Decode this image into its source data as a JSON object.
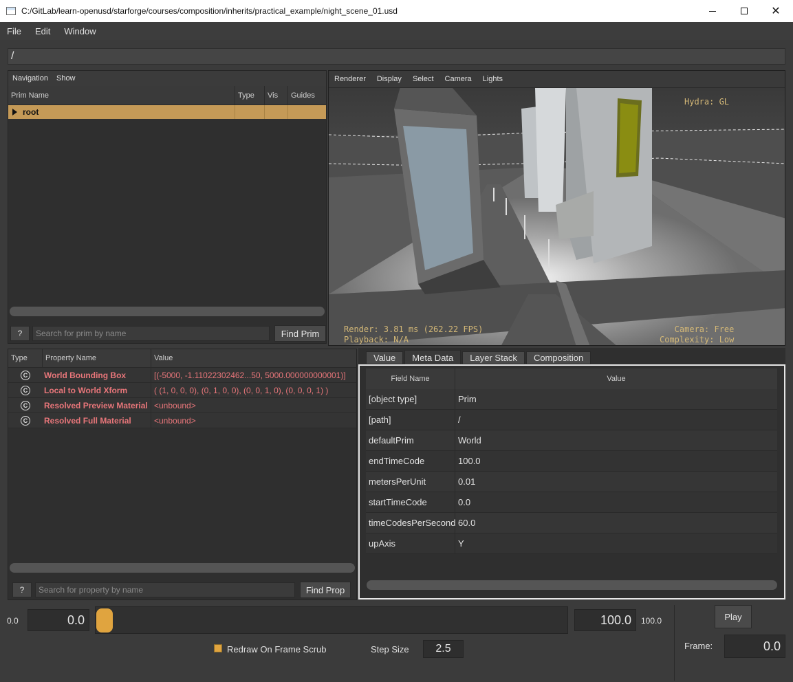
{
  "window": {
    "title": "C:/GitLab/learn-openusd/starforge/courses/composition/inherits/practical_example/night_scene_01.usd",
    "minimize_icon": "minimize-icon",
    "maximize_icon": "maximize-icon",
    "close_icon": "close-icon"
  },
  "menu": [
    "File",
    "Edit",
    "Window"
  ],
  "path_bar": {
    "value": "/"
  },
  "prim_panel": {
    "toolbar": [
      "Navigation",
      "Show"
    ],
    "columns": [
      "Prim Name",
      "Type",
      "Vis",
      "Guides"
    ],
    "rows": [
      {
        "name": "root",
        "type": "",
        "vis": "",
        "guides": ""
      }
    ],
    "help_label": "?",
    "search_placeholder": "Search for prim by name",
    "find_label": "Find Prim"
  },
  "viewport": {
    "toolbar": [
      "Renderer",
      "Display",
      "Select",
      "Camera",
      "Lights"
    ],
    "hud_top_right": "Hydra: GL",
    "hud_bottom_left": "Render: 3.81 ms (262.22 FPS)\nPlayback: N/A",
    "hud_bottom_right": "Camera: Free\nComplexity: Low"
  },
  "property_panel": {
    "columns": [
      "Type",
      "Property Name",
      "Value"
    ],
    "rows": [
      {
        "icon": "computed-icon",
        "type_glyph": "C",
        "name": "World Bounding Box",
        "value": "[(-5000, -1.11022302462...50, 5000.000000000001)]"
      },
      {
        "icon": "computed-icon",
        "type_glyph": "C",
        "name": "Local to World Xform",
        "value": "( (1, 0, 0, 0), (0, 1, 0, 0), (0, 0, 1, 0), (0, 0, 0, 1) )"
      },
      {
        "icon": "computed-icon",
        "type_glyph": "C",
        "name": "Resolved Preview Material",
        "value": "<unbound>"
      },
      {
        "icon": "computed-icon",
        "type_glyph": "C",
        "name": "Resolved Full Material",
        "value": "<unbound>"
      }
    ],
    "help_label": "?",
    "search_placeholder": "Search for property by name",
    "find_label": "Find Prop"
  },
  "meta_panel": {
    "tabs": [
      "Value",
      "Meta Data",
      "Layer Stack",
      "Composition"
    ],
    "active_tab": "Meta Data",
    "columns": [
      "Field Name",
      "Value"
    ],
    "rows": [
      {
        "field": "[object type]",
        "value": "Prim"
      },
      {
        "field": "[path]",
        "value": "/"
      },
      {
        "field": "defaultPrim",
        "value": "World"
      },
      {
        "field": "endTimeCode",
        "value": "100.0"
      },
      {
        "field": "metersPerUnit",
        "value": "0.01"
      },
      {
        "field": "startTimeCode",
        "value": "0.0"
      },
      {
        "field": "timeCodesPerSecond",
        "value": "60.0"
      },
      {
        "field": "upAxis",
        "value": "Y"
      }
    ]
  },
  "timeline": {
    "range_start_label": "0.0",
    "start_value": "0.0",
    "end_value": "100.0",
    "range_end_label": "100.0",
    "play_label": "Play",
    "redraw_label": "Redraw On Frame Scrub",
    "redraw_checked": true,
    "step_size_label": "Step Size",
    "step_size_value": "2.5",
    "frame_label": "Frame:",
    "frame_value": "0.0",
    "slider_position": 0.0
  },
  "colors": {
    "accent": "#e0a43f",
    "selected_row": "#c59a57",
    "property_text": "#e8767a",
    "hud_text": "#d4b877"
  }
}
